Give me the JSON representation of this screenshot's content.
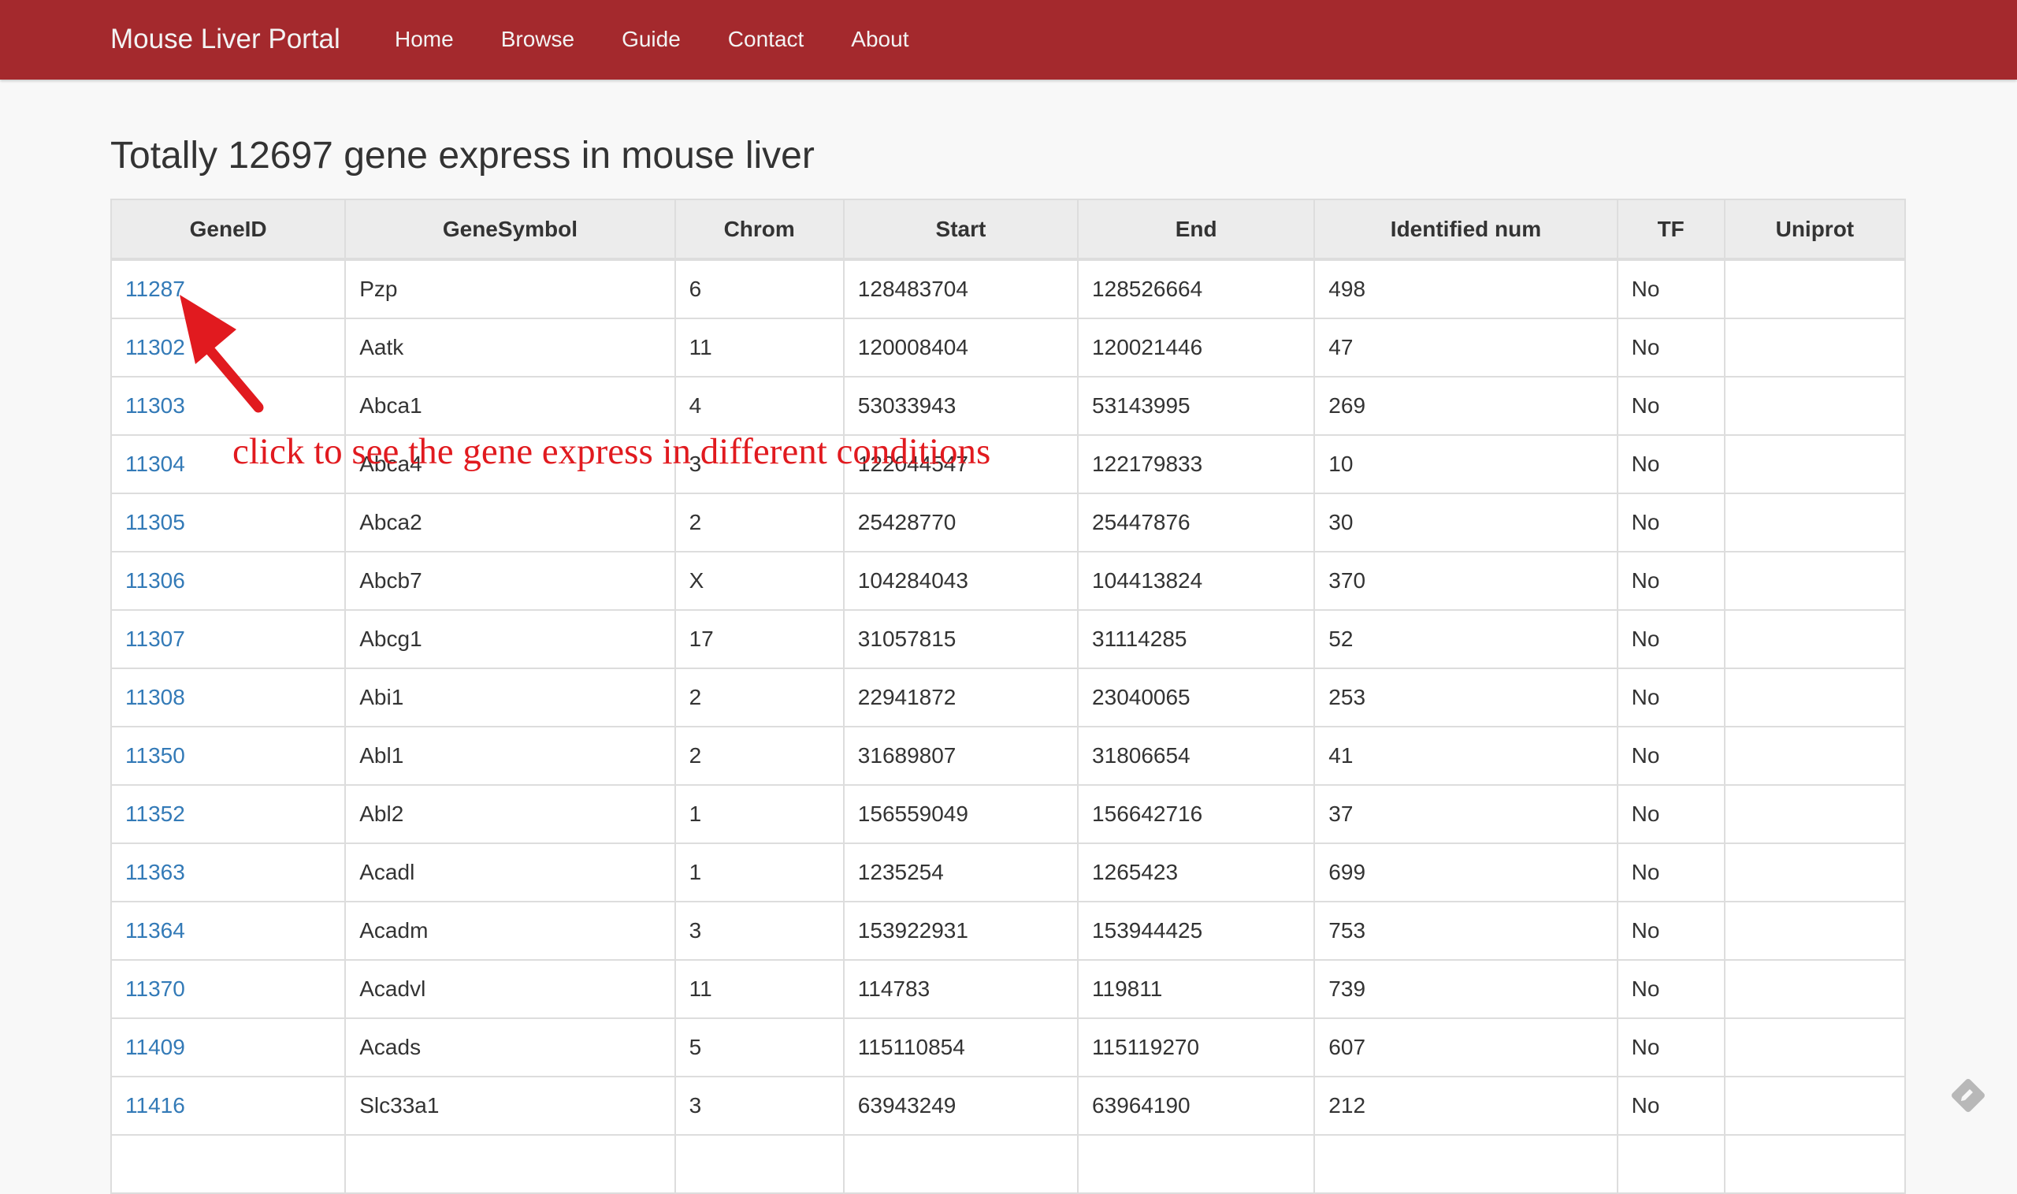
{
  "nav": {
    "brand": "Mouse Liver Portal",
    "links": [
      "Home",
      "Browse",
      "Guide",
      "Contact",
      "About"
    ]
  },
  "page_title": "Totally 12697 gene express in mouse liver",
  "table": {
    "columns": [
      "GeneID",
      "GeneSymbol",
      "Chrom",
      "Start",
      "End",
      "Identified num",
      "TF",
      "Uniprot"
    ],
    "rows": [
      [
        "11287",
        "Pzp",
        "6",
        "128483704",
        "128526664",
        "498",
        "No",
        ""
      ],
      [
        "11302",
        "Aatk",
        "11",
        "120008404",
        "120021446",
        "47",
        "No",
        ""
      ],
      [
        "11303",
        "Abca1",
        "4",
        "53033943",
        "53143995",
        "269",
        "No",
        ""
      ],
      [
        "11304",
        "Abca4",
        "3",
        "122044547",
        "122179833",
        "10",
        "No",
        ""
      ],
      [
        "11305",
        "Abca2",
        "2",
        "25428770",
        "25447876",
        "30",
        "No",
        ""
      ],
      [
        "11306",
        "Abcb7",
        "X",
        "104284043",
        "104413824",
        "370",
        "No",
        ""
      ],
      [
        "11307",
        "Abcg1",
        "17",
        "31057815",
        "31114285",
        "52",
        "No",
        ""
      ],
      [
        "11308",
        "Abi1",
        "2",
        "22941872",
        "23040065",
        "253",
        "No",
        ""
      ],
      [
        "11350",
        "Abl1",
        "2",
        "31689807",
        "31806654",
        "41",
        "No",
        ""
      ],
      [
        "11352",
        "Abl2",
        "1",
        "156559049",
        "156642716",
        "37",
        "No",
        ""
      ],
      [
        "11363",
        "Acadl",
        "1",
        "1235254",
        "1265423",
        "699",
        "No",
        ""
      ],
      [
        "11364",
        "Acadm",
        "3",
        "153922931",
        "153944425",
        "753",
        "No",
        ""
      ],
      [
        "11370",
        "Acadvl",
        "11",
        "114783",
        "119811",
        "739",
        "No",
        ""
      ],
      [
        "11409",
        "Acads",
        "5",
        "115110854",
        "115119270",
        "607",
        "No",
        ""
      ],
      [
        "11416",
        "Slc33a1",
        "3",
        "63943249",
        "63964190",
        "212",
        "No",
        ""
      ],
      [
        "",
        "",
        "",
        "",
        "",
        "",
        "",
        ""
      ]
    ]
  },
  "annotation": {
    "text": "click to see the gene express in different conditions",
    "color": "#e11a1f"
  },
  "colors": {
    "navbar": "#a4292d",
    "link": "#337ab7",
    "background": "#f8f8f8"
  },
  "icons": {
    "scroll_widget": "pencil-diamond-icon",
    "annotation_arrow": "arrow-icon"
  }
}
